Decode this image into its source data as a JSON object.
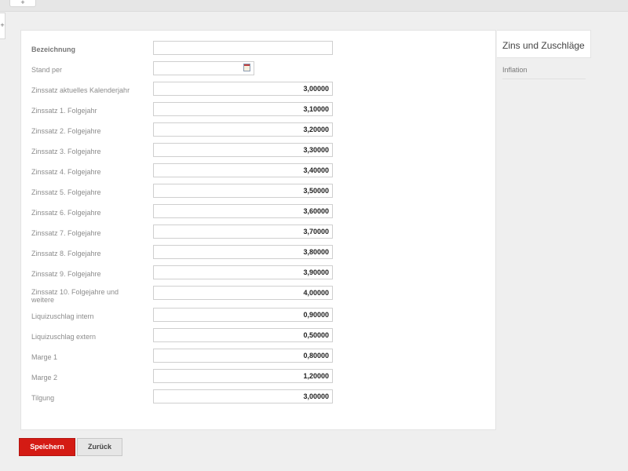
{
  "top_tab_icon": "plus-icon",
  "form": {
    "rows": [
      {
        "label": "Bezeichnung",
        "value": ""
      },
      {
        "label": "Stand per",
        "value": ""
      },
      {
        "label": "Zinssatz aktuelles Kalenderjahr",
        "value": "3,00000"
      },
      {
        "label": "Zinssatz 1. Folgejahr",
        "value": "3,10000"
      },
      {
        "label": "Zinssatz 2. Folgejahre",
        "value": "3,20000"
      },
      {
        "label": "Zinssatz 3. Folgejahre",
        "value": "3,30000"
      },
      {
        "label": "Zinssatz 4. Folgejahre",
        "value": "3,40000"
      },
      {
        "label": "Zinssatz 5. Folgejahre",
        "value": "3,50000"
      },
      {
        "label": "Zinssatz 6. Folgejahre",
        "value": "3,60000"
      },
      {
        "label": "Zinssatz 7. Folgejahre",
        "value": "3,70000"
      },
      {
        "label": "Zinssatz 8. Folgejahre",
        "value": "3,80000"
      },
      {
        "label": "Zinssatz 9. Folgejahre",
        "value": "3,90000"
      },
      {
        "label": "Zinssatz 10. Folgejahre und weitere",
        "value": "4,00000"
      },
      {
        "label": "Liquizuschlag intern",
        "value": "0,90000"
      },
      {
        "label": "Liquizuschlag extern",
        "value": "0,50000"
      },
      {
        "label": "Marge 1",
        "value": "0,80000"
      },
      {
        "label": "Marge 2",
        "value": "1,20000"
      },
      {
        "label": "Tilgung",
        "value": "3,00000"
      }
    ]
  },
  "right_panel": {
    "title": "Zins und Zuschläge",
    "items": [
      "Inflation"
    ]
  },
  "buttons": {
    "save": "Speichern",
    "back": "Zurück"
  },
  "colors": {
    "accent": "#d41b14"
  }
}
